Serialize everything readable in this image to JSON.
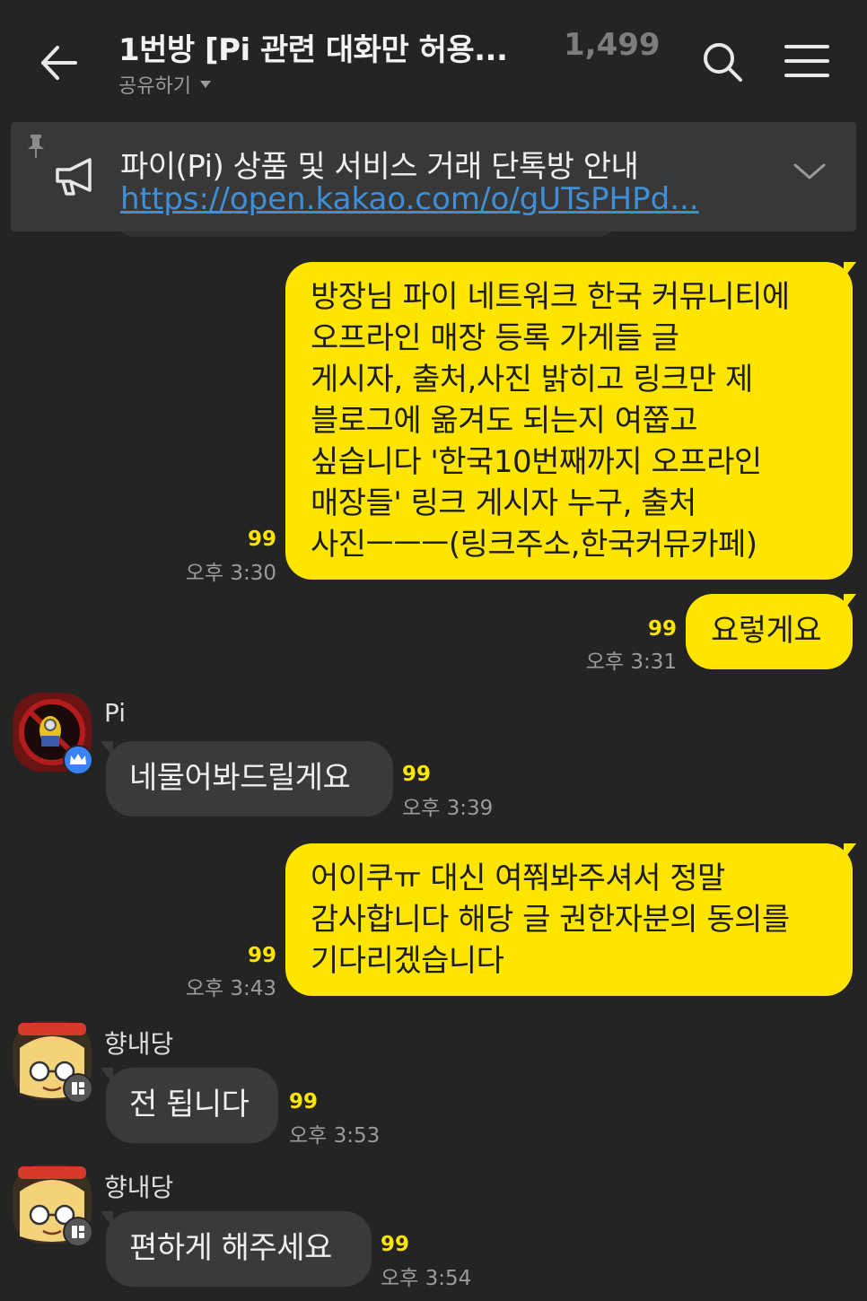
{
  "header": {
    "title": "1번방 [Pi 관련 대화만 허용...",
    "member_count": "1,499",
    "share_label": "공유하기"
  },
  "notice": {
    "title": "파이(Pi) 상품 및 서비스 거래 단톡방 안내",
    "link": "https://open.kakao.com/o/gUTsPHPd..."
  },
  "messages": [
    {
      "from": "me",
      "text": "방장님 파이 네트워크 한국 커뮤니티에\n오프라인 매장 등록 가게들      글\n게시자, 출처,사진 밝히고 링크만 제\n블로그에 옮겨도 되는지 여쭙고\n싶습니다   '한국10번째까지 오프라인\n매장들' 링크 게시자 누구, 출처\n사진ㅡㅡㅡ(링크주소,한국커뮤카페)",
      "unread": "99",
      "time": "오후 3:30"
    },
    {
      "from": "me",
      "text": "요렇게요",
      "unread": "99",
      "time": "오후 3:31"
    },
    {
      "from": "Pi",
      "text": "네물어봐드릴게요",
      "unread": "99",
      "time": "오후 3:39"
    },
    {
      "from": "me",
      "text": "어이쿠ㅠ 대신 여쭤봐주셔서 정말\n감사합니다 해당 글 권한자분의 동의를\n기다리겠습니다",
      "unread": "99",
      "time": "오후 3:43"
    },
    {
      "from": "향내당",
      "text": "전 됩니다",
      "unread": "99",
      "time": "오후 3:53"
    },
    {
      "from": "향내당",
      "text": "편하게 해주세요",
      "unread": "99",
      "time": "오후 3:54"
    }
  ],
  "colors": {
    "background": "#242424",
    "my_bubble": "#fee500",
    "their_bubble": "#3a3a3a",
    "unread_count": "#fee500",
    "link": "#3f8fd8"
  },
  "icons": {
    "back": "back-arrow-icon",
    "search": "search-icon",
    "menu": "hamburger-menu-icon",
    "notice": "megaphone-icon",
    "pin": "pin-icon",
    "expand": "chevron-down-icon",
    "host_badge": "crown-icon",
    "profile_badge": "profile-badge-icon"
  }
}
